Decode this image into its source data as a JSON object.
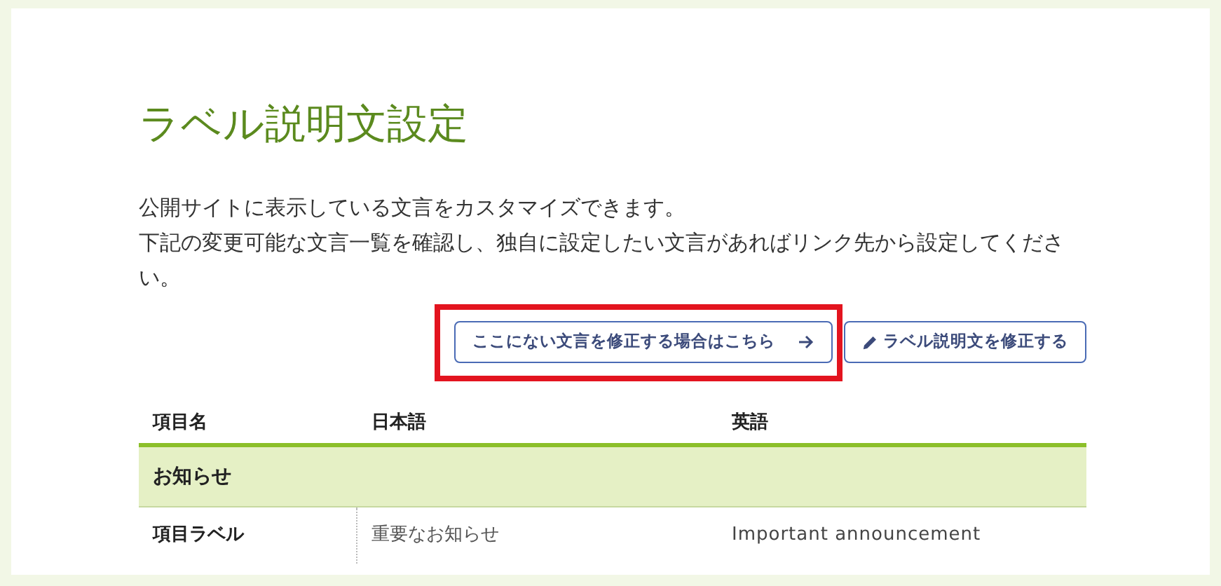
{
  "title": "ラベル説明文設定",
  "description": [
    "公開サイトに表示している文言をカスタマイズできます。",
    "下記の変更可能な文言一覧を確認し、独自に設定したい文言があればリンク先から設定してください。"
  ],
  "buttons": [
    {
      "label": "ここにない文言を修正する場合はこちら",
      "kind": "link",
      "highlighted": true
    },
    {
      "label": "ラベル説明文を修正する",
      "kind": "edit",
      "highlighted": false
    }
  ],
  "table": {
    "columns": [
      "項目名",
      "日本語",
      "英語"
    ],
    "groups": [
      {
        "title": "お知らせ",
        "rows": [
          {
            "name": "項目ラベル",
            "ja": "重要なお知らせ",
            "en": "Important announcement"
          }
        ]
      }
    ]
  }
}
